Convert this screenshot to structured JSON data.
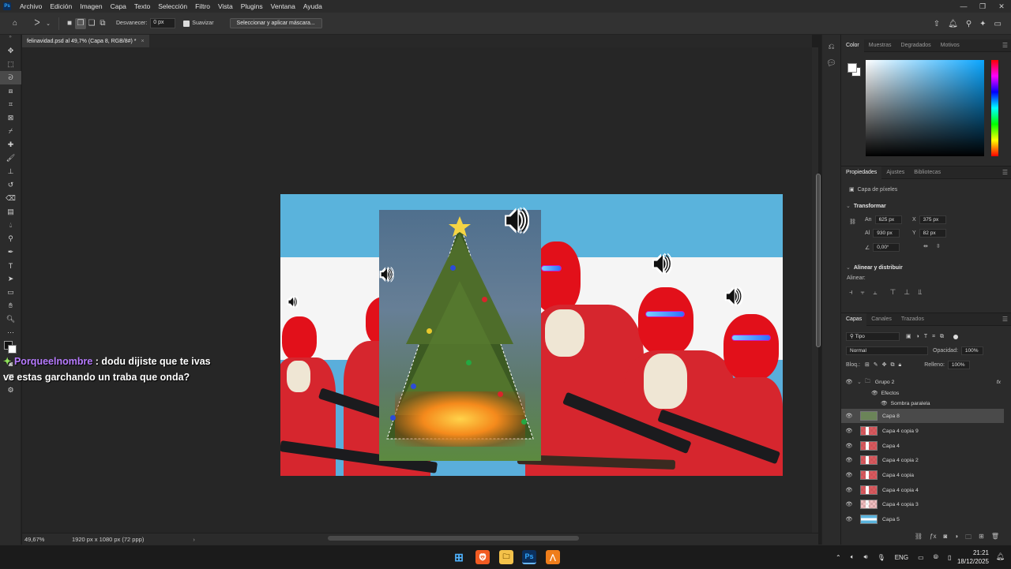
{
  "app": {
    "logo": "Ps",
    "menu": [
      "Archivo",
      "Edición",
      "Imagen",
      "Capa",
      "Texto",
      "Selección",
      "Filtro",
      "Vista",
      "Plugins",
      "Ventana",
      "Ayuda"
    ],
    "window_controls": [
      "—",
      "❐",
      "✕"
    ]
  },
  "options": {
    "feather_label": "Desvanecer:",
    "feather_value": "0 px",
    "antialias_label": "Suavizar",
    "mask_button": "Seleccionar y aplicar máscara..."
  },
  "document": {
    "tab_title": "felinavidad.psd al 49,7% (Capa 8, RGB/8#) *",
    "tab_close": "×",
    "zoom": "49,67%",
    "doc_info": "1920 px x 1080 px (72 ppp)"
  },
  "chat": {
    "username": "Porqueelnombre",
    "message_line1": ": dodu dijiste que te ivas",
    "message_line2": "ve estas garchando un traba que onda?"
  },
  "color_panel": {
    "tabs": [
      "Color",
      "Muestras",
      "Degradados",
      "Motivos"
    ],
    "active_tab": "Color"
  },
  "properties": {
    "tabs": [
      "Propiedades",
      "Ajustes",
      "Bibliotecas"
    ],
    "layer_type": "Capa de píxeles",
    "transform_title": "Transformar",
    "w_label": "An",
    "w_value": "625 px",
    "h_label": "Al",
    "h_value": "930 px",
    "x_label": "X",
    "x_value": "375 px",
    "y_label": "Y",
    "y_value": "82 px",
    "angle_value": "0,00°",
    "align_title": "Alinear y distribuir",
    "align_label": "Alinear:"
  },
  "layers": {
    "tabs": [
      "Capas",
      "Canales",
      "Trazados"
    ],
    "filter_kind": "Tipo",
    "blend_mode": "Normal",
    "opacity_label": "Opacidad:",
    "opacity_value": "100%",
    "lock_label": "Bloq.:",
    "fill_label": "Relleno:",
    "fill_value": "100%",
    "items": [
      {
        "name": "Grupo 2",
        "fx": "fx"
      },
      {
        "name": "Efectos"
      },
      {
        "name": "Sombra paralela"
      },
      {
        "name": "Capa 8"
      },
      {
        "name": "Capa 4 copia 9"
      },
      {
        "name": "Capa 4"
      },
      {
        "name": "Capa 4 copia 2"
      },
      {
        "name": "Capa 4 copia"
      },
      {
        "name": "Capa 4 copia 4"
      },
      {
        "name": "Capa 4 copia 3"
      },
      {
        "name": "Capa 5"
      }
    ]
  },
  "taskbar": {
    "lang": "ENG",
    "time": "21:21",
    "date": "18/12/2025"
  }
}
